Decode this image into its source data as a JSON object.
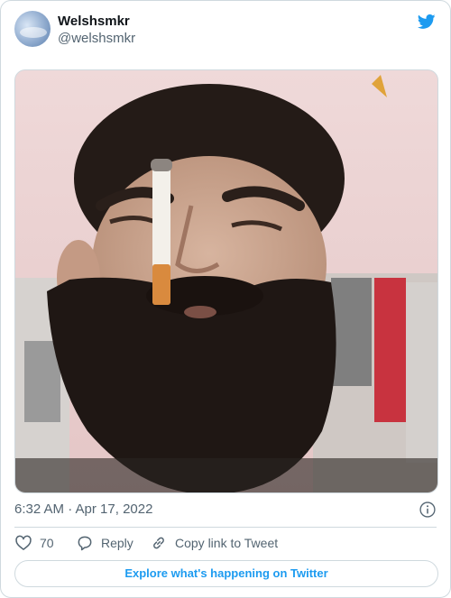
{
  "tweet": {
    "author_name": "Welshsmkr",
    "author_handle": "@welshsmkr",
    "timestamp": "6:32 AM · Apr 17, 2022",
    "like_count": "70",
    "reply_label": "Reply",
    "copy_label": "Copy link to Tweet",
    "explore_label": "Explore what's happening on Twitter"
  },
  "colors": {
    "brand": "#1d9bf0",
    "text_secondary": "#536471",
    "border": "#cfd9de"
  },
  "icons": {
    "platform": "twitter-bird-icon",
    "info": "info-icon",
    "like": "heart-icon",
    "reply": "reply-bubble-icon",
    "copy": "link-icon"
  }
}
